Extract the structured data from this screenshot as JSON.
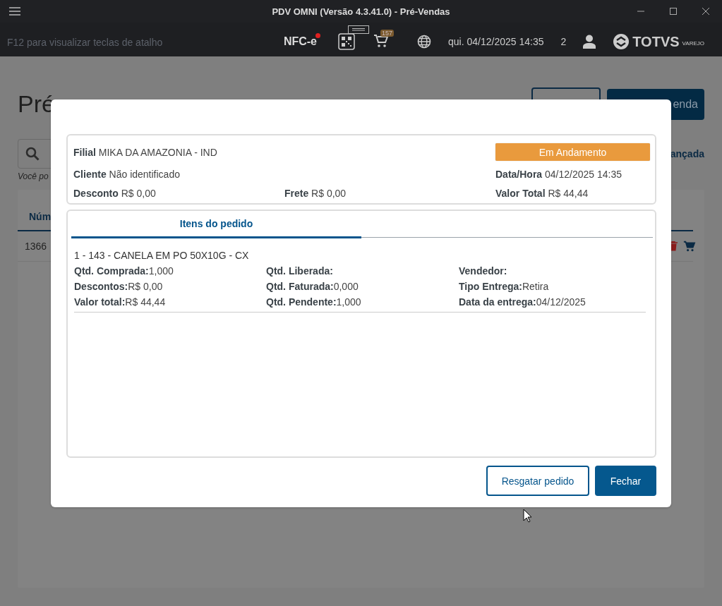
{
  "window": {
    "title": "PDV OMNI (Versão 4.3.41.0) - Pré-Vendas"
  },
  "toolbar": {
    "hint": "F12 para visualizar teclas de atalho",
    "nfce_label": "NFC-e",
    "nfce_alert": true,
    "cart_count": "157",
    "datetime": "qui. 04/12/2025 14:35",
    "user_count": "2",
    "logo_brand": "TOTVS",
    "logo_sub": "VAREJO"
  },
  "background_page": {
    "title": "Pré",
    "primary_button": "enda",
    "search_hint": "Você po",
    "advanced_link": "ançada",
    "table_header": "Núm",
    "row_number": "1366"
  },
  "dialog": {
    "order": {
      "status": "Em Andamento",
      "rows": [
        {
          "left": {
            "label": "Filial",
            "value": "MIKA DA AMAZONIA - IND"
          }
        },
        {
          "left": {
            "label": "Cliente",
            "value": "Não identificado"
          },
          "right": {
            "label": "Data/Hora",
            "value": "04/12/2025 14:35"
          }
        },
        {
          "left": {
            "label": "Desconto",
            "value": "R$ 0,00"
          },
          "middle": {
            "label": "Frete",
            "value": "R$ 0,00"
          },
          "right": {
            "label": "Valor Total",
            "value": "R$ 44,44"
          }
        }
      ]
    },
    "tabs": [
      {
        "label": "Itens do pedido",
        "selected": true
      }
    ],
    "items": [
      {
        "title": "1 - 143 - CANELA EM PO 50X10G - CX",
        "columns": [
          [
            {
              "label": "Qtd. Comprada:",
              "value": "1,000"
            },
            {
              "label": "Descontos:",
              "value": "R$ 0,00"
            },
            {
              "label": "Valor total:",
              "value": "R$ 44,44"
            }
          ],
          [
            {
              "label": "Qtd. Liberada:"
            },
            {
              "label": "Qtd. Faturada:",
              "value": "0,000"
            },
            {
              "label": "Qtd. Pendente:",
              "value": "1,000"
            }
          ],
          [
            {
              "label": "Vendedor:"
            },
            {
              "label": "Tipo Entrega:",
              "value": "Retira"
            },
            {
              "label": "Data da entrega:",
              "value": "04/12/2025"
            }
          ]
        ]
      }
    ],
    "buttons": [
      {
        "label": "Resgatar pedido",
        "kind": "outline"
      },
      {
        "label": "Fechar",
        "kind": "primary"
      }
    ]
  }
}
